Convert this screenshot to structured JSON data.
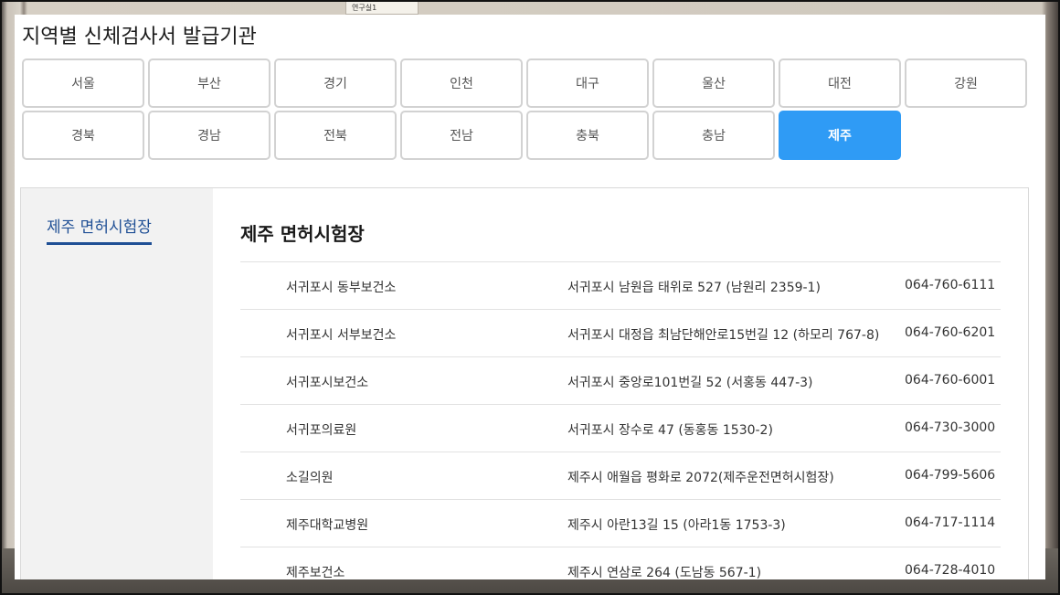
{
  "page": {
    "title": "지역별 신체검사서 발급기관"
  },
  "regions": [
    {
      "label": "서울",
      "active": false
    },
    {
      "label": "부산",
      "active": false
    },
    {
      "label": "경기",
      "active": false
    },
    {
      "label": "인천",
      "active": false
    },
    {
      "label": "대구",
      "active": false
    },
    {
      "label": "울산",
      "active": false
    },
    {
      "label": "대전",
      "active": false
    },
    {
      "label": "강원",
      "active": false
    },
    {
      "label": "경북",
      "active": false
    },
    {
      "label": "경남",
      "active": false
    },
    {
      "label": "전북",
      "active": false
    },
    {
      "label": "전남",
      "active": false
    },
    {
      "label": "충북",
      "active": false
    },
    {
      "label": "충남",
      "active": false
    },
    {
      "label": "제주",
      "active": true
    }
  ],
  "side_tabs": [
    {
      "label": "제주 면허시험장"
    }
  ],
  "section": {
    "title": "제주 면허시험장"
  },
  "institutions": [
    {
      "name": "서귀포시 동부보건소",
      "address": "서귀포시 남원읍 태위로 527 (남원리 2359-1)",
      "phone": "064-760-6111"
    },
    {
      "name": "서귀포시 서부보건소",
      "address": "서귀포시 대정읍 최남단해안로15번길 12 (하모리 767-8)",
      "phone": "064-760-6201"
    },
    {
      "name": "서귀포시보건소",
      "address": "서귀포시 중앙로101번길 52 (서홍동 447-3)",
      "phone": "064-760-6001"
    },
    {
      "name": "서귀포의료원",
      "address": "서귀포시 장수로 47 (동홍동 1530-2)",
      "phone": "064-730-3000"
    },
    {
      "name": "소길의원",
      "address": "제주시 애월읍 평화로 2072(제주운전면허시험장)",
      "phone": "064-799-5606"
    },
    {
      "name": "제주대학교병원",
      "address": "제주시 아란13길 15 (아라1동 1753-3)",
      "phone": "064-717-1114"
    },
    {
      "name": "제주보건소",
      "address": "제주시 연삼로 264 (도남동 567-1)",
      "phone": "064-728-4010"
    }
  ],
  "background": {
    "sign_text": "연구실1"
  },
  "colors": {
    "active_region": "#2f9bf5",
    "side_tab": "#1f4f95"
  }
}
